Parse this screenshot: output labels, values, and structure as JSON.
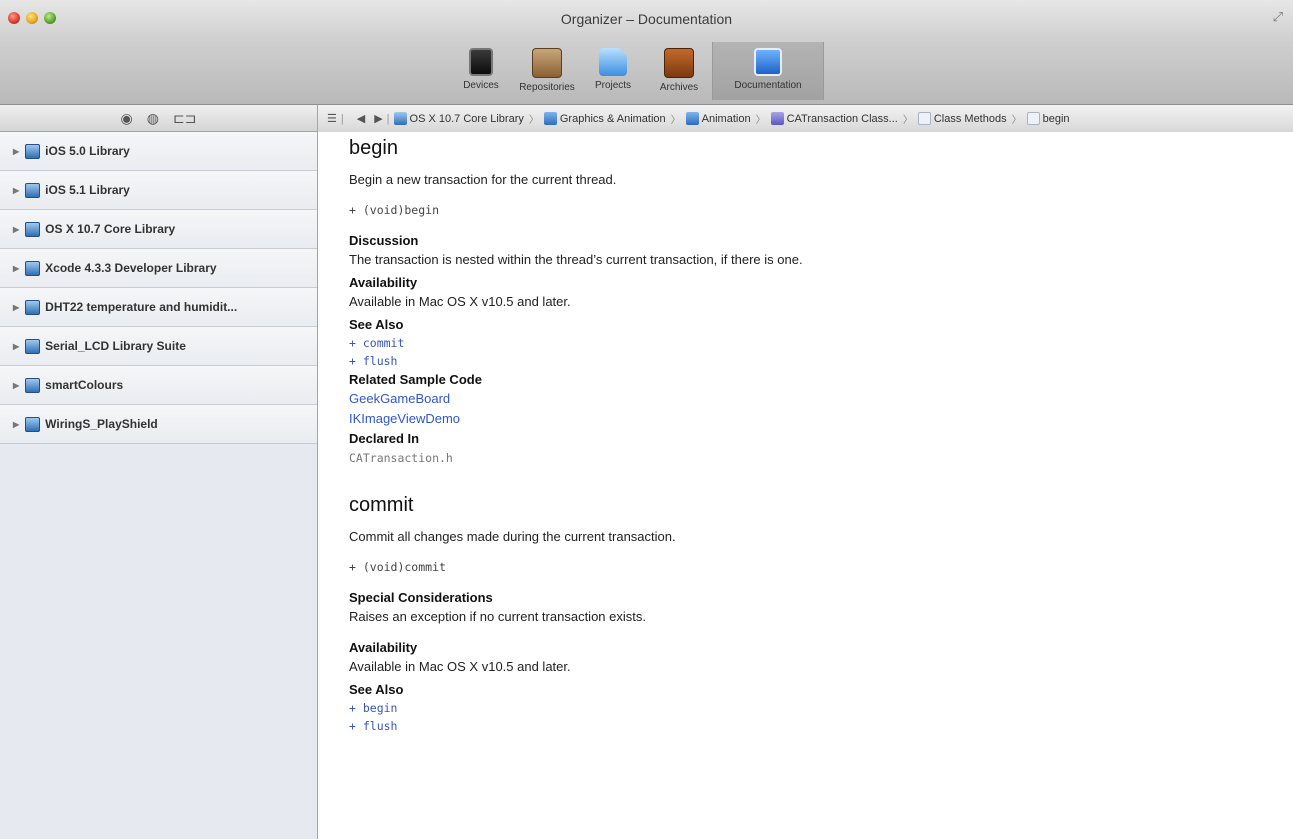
{
  "window": {
    "title": "Organizer – Documentation"
  },
  "toolbar": {
    "buttons": [
      {
        "label": "Devices",
        "icon": "devices-icon"
      },
      {
        "label": "Repositories",
        "icon": "repositories-icon"
      },
      {
        "label": "Projects",
        "icon": "projects-icon"
      },
      {
        "label": "Archives",
        "icon": "archives-icon"
      },
      {
        "label": "Documentation",
        "icon": "documentation-icon",
        "selected": true
      }
    ]
  },
  "sidebar_header": {
    "icons": [
      "eye-icon",
      "bookmark-icon",
      "book-icon"
    ],
    "glyphs": [
      "◉",
      "◍",
      "⊏⊐"
    ]
  },
  "sidebar": {
    "libraries": [
      {
        "label": "iOS 5.0 Library"
      },
      {
        "label": "iOS 5.1 Library"
      },
      {
        "label": "OS X 10.7 Core Library"
      },
      {
        "label": "Xcode 4.3.3 Developer Library"
      },
      {
        "label": "DHT22 temperature and humidit..."
      },
      {
        "label": "Serial_LCD Library Suite"
      },
      {
        "label": "smartColours"
      },
      {
        "label": "WiringS_PlayShield"
      }
    ]
  },
  "jumpbar": {
    "crumbs": [
      {
        "label": "OS X 10.7 Core Library",
        "icon": "library-icon"
      },
      {
        "label": "Graphics & Animation",
        "icon": "folder-icon"
      },
      {
        "label": "Animation",
        "icon": "folder-icon"
      },
      {
        "label": "CATransaction Class...",
        "icon": "class-icon"
      },
      {
        "label": "Class Methods",
        "icon": "document-icon"
      },
      {
        "label": "begin",
        "icon": "document-icon"
      }
    ]
  },
  "doc": {
    "methods": [
      {
        "name": "begin",
        "abstract": "Begin a new transaction for the current thread.",
        "declaration": "+ (void)begin",
        "discussion_heading": "Discussion",
        "discussion": "The transaction is nested within the thread’s current transaction, if there is one.",
        "availability_heading": "Availability",
        "availability": "Available in Mac OS X v10.5 and later.",
        "see_also_heading": "See Also",
        "see_also": [
          "+ commit",
          "+ flush"
        ],
        "sample_heading": "Related Sample Code",
        "samples": [
          "GeekGameBoard",
          "IKImageViewDemo"
        ],
        "declared_heading": "Declared In",
        "declared_in": "CATransaction.h"
      },
      {
        "name": "commit",
        "abstract": "Commit all changes made during the current transaction.",
        "declaration": "+ (void)commit",
        "special_heading": "Special Considerations",
        "special": "Raises an exception if no current transaction exists.",
        "availability_heading": "Availability",
        "availability": "Available in Mac OS X v10.5 and later.",
        "see_also_heading": "See Also",
        "see_also": [
          "+ begin",
          "+ flush"
        ]
      }
    ]
  }
}
